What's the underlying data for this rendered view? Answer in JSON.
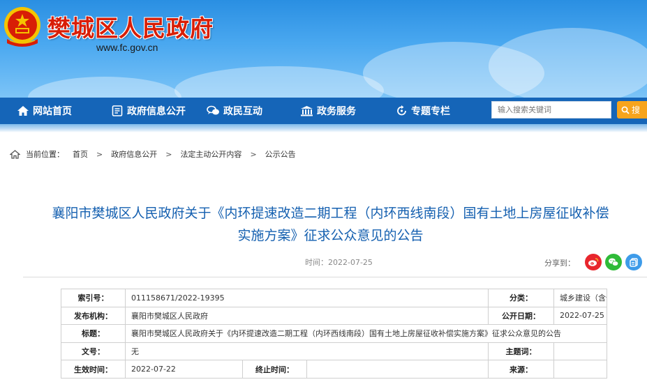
{
  "header": {
    "site_title": "樊城区人民政府",
    "site_url": "www.fc.gov.cn"
  },
  "nav": {
    "items": [
      {
        "label": "网站首页",
        "icon": "home-icon"
      },
      {
        "label": "政府信息公开",
        "icon": "document-list-icon"
      },
      {
        "label": "政民互动",
        "icon": "chat-bubbles-icon"
      },
      {
        "label": "政务服务",
        "icon": "government-building-icon"
      },
      {
        "label": "专题专栏",
        "icon": "refresh-icon"
      }
    ],
    "search_placeholder": "输入搜索关键词",
    "search_label": "搜"
  },
  "breadcrumb": {
    "prefix": "当前位置：",
    "items": [
      "首页",
      "政府信息公开",
      "法定主动公开内容",
      "公示公告"
    ],
    "separator": ">"
  },
  "article": {
    "title_line1": "襄阳市樊城区人民政府关于《内环提速改造二期工程（内环西线南段）国有土地上房屋征收补偿",
    "title_line2": "实施方案》征求公众意见的公告",
    "time": "时间：2022-07-25",
    "share_label": "分享到："
  },
  "info_table": {
    "index_label": "索引号：",
    "index_value": "011158671/2022-19395",
    "category_label": "分类：",
    "category_value": "城乡建设（含住房）",
    "publisher_label": "发布机构：",
    "publisher_value": "襄阳市樊城区人民政府",
    "pubdate_label": "公开日期：",
    "pubdate_value": "2022-07-25",
    "title_label": "标题：",
    "title_value": "襄阳市樊城区人民政府关于《内环提速改造二期工程（内环西线南段）国有土地上房屋征收补偿实施方案》征求公众意见的公告",
    "docno_label": "文号：",
    "docno_value": "无",
    "subject_label": "主题词：",
    "subject_value": "",
    "effective_label": "生效时间：",
    "effective_value": "2022-07-22",
    "expire_label": "终止时间：",
    "expire_value": "",
    "source_label": "来源：",
    "source_value": ""
  },
  "colors": {
    "nav_bg": "#1565b8",
    "title_blue": "#1560b0",
    "brand_red": "#d81e06",
    "search_orange": "#f7a41c"
  }
}
